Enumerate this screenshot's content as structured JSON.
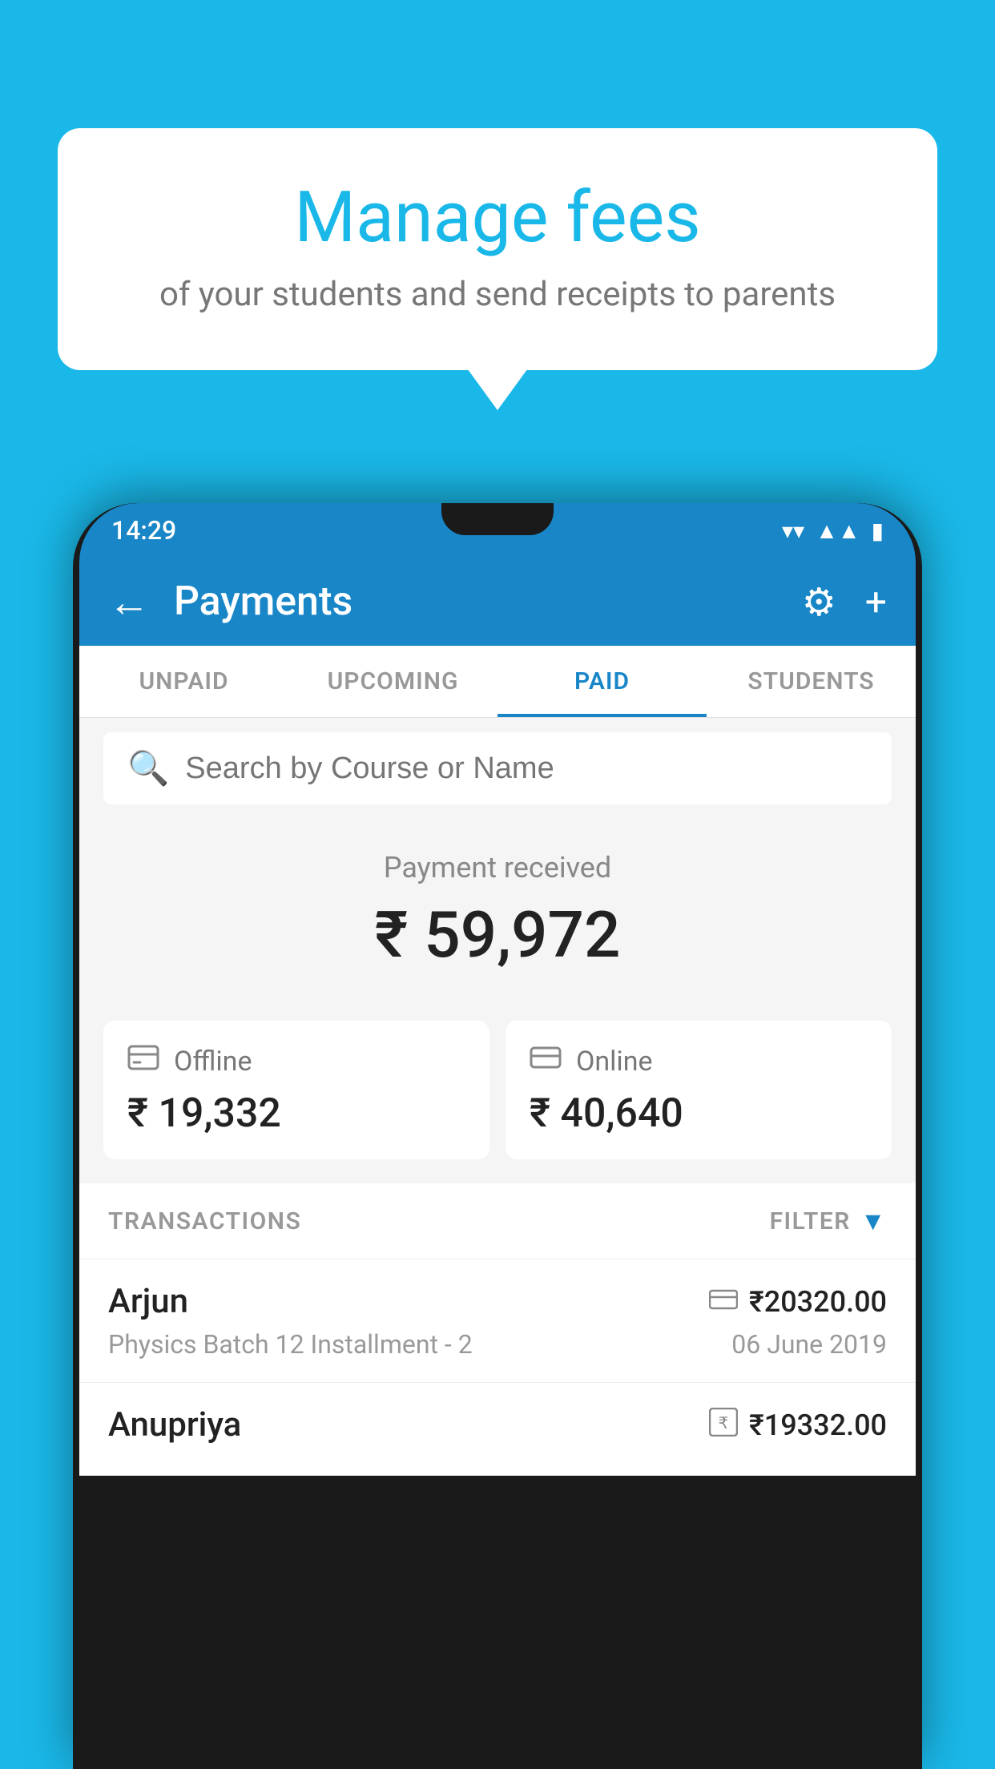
{
  "background": "#1ab8e8",
  "bubble": {
    "heading": "Manage fees",
    "subtext": "of your students and send receipts to parents"
  },
  "statusBar": {
    "time": "14:29",
    "icons": [
      "wifi",
      "signal",
      "battery"
    ]
  },
  "appBar": {
    "title": "Payments",
    "backIcon": "←",
    "settingsIcon": "⚙",
    "addIcon": "+"
  },
  "tabs": [
    {
      "label": "UNPAID",
      "active": false
    },
    {
      "label": "UPCOMING",
      "active": false
    },
    {
      "label": "PAID",
      "active": true
    },
    {
      "label": "STUDENTS",
      "active": false
    }
  ],
  "search": {
    "placeholder": "Search by Course or Name"
  },
  "paymentReceived": {
    "label": "Payment received",
    "amount": "₹ 59,972"
  },
  "cards": [
    {
      "icon": "offline",
      "label": "Offline",
      "amount": "₹ 19,332"
    },
    {
      "icon": "online",
      "label": "Online",
      "amount": "₹ 40,640"
    }
  ],
  "transactionsHeader": {
    "label": "TRANSACTIONS",
    "filterLabel": "FILTER"
  },
  "transactions": [
    {
      "name": "Arjun",
      "course": "Physics Batch 12 Installment - 2",
      "amount": "₹20320.00",
      "date": "06 June 2019",
      "paymentType": "online"
    },
    {
      "name": "Anupriya",
      "course": "",
      "amount": "₹19332.00",
      "date": "",
      "paymentType": "offline"
    }
  ]
}
